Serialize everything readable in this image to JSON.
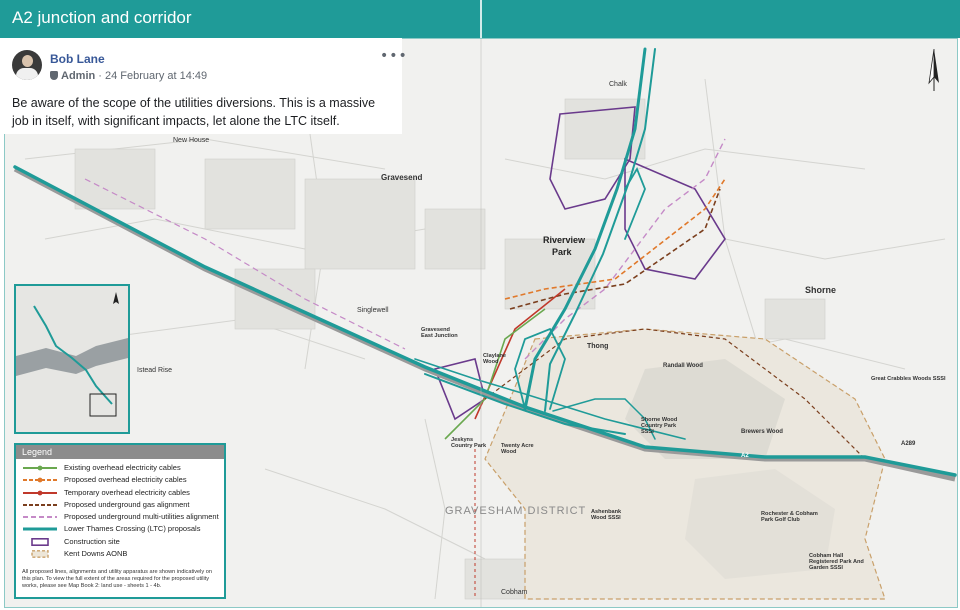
{
  "header": {
    "title": "A2 junction and corridor"
  },
  "post": {
    "author": "Bob Lane",
    "role": "Admin",
    "date": "24 February at 14:49",
    "more": "•••",
    "text": "Be aware of the scope of the utilities diversions. This is a massive job in itself, with significant impacts, let alone the LTC itself."
  },
  "map": {
    "labels": {
      "gravesend": "Gravesend",
      "riverview": "Riverview",
      "park": "Park",
      "shorne": "Shorne",
      "singlewell": "Singlewell",
      "chalk": "Chalk",
      "thong": "Thong",
      "randall_wood": "Randall Wood",
      "brewers_wood": "Brewers Wood",
      "great_crabbles": "Great Crabbles Woods SSSI",
      "gravesham": "GRAVESHAM DISTRICT",
      "cobham": "Cobham",
      "ashenbank": "Ashenbank Wood SSSI",
      "rochester_cobham": "Rochester & Cobham Park Golf Club",
      "cobham_hall": "Cobham Hall Registered Park And Garden SSSI",
      "jeskyns": "Jeskyns Country Park",
      "istead_rise": "Istead Rise",
      "new_house": "New House",
      "gravesend_east": "Gravesend East Junction",
      "shorne_wood": "Shorne Wood Country Park SSSI",
      "twenty_acre": "Twenty Acre Wood",
      "claylane": "Claylane Wood",
      "a2": "A2",
      "a289": "A289"
    },
    "legend": {
      "title": "Legend",
      "items": [
        {
          "label": "Existing overhead electricity cables",
          "color": "#6aa84f",
          "style": "solid-dot"
        },
        {
          "label": "Proposed overhead electricity cables",
          "color": "#e0792b",
          "style": "dash"
        },
        {
          "label": "Temporary overhead electricity cables",
          "color": "#c0392b",
          "style": "solid-dot"
        },
        {
          "label": "Proposed underground gas alignment",
          "color": "#7b3f1e",
          "style": "dash"
        },
        {
          "label": "Proposed underground multi-utilities alignment",
          "color": "#c58ac7",
          "style": "dash"
        },
        {
          "label": "Lower Thames Crossing (LTC) proposals",
          "color": "#1f9b98",
          "style": "solid"
        },
        {
          "label": "Construction site",
          "color": "#6a3a8c",
          "style": "box"
        },
        {
          "label": "Kent Downs AONB",
          "color": "#c9a06a",
          "style": "dashbox"
        }
      ],
      "note": "All proposed lines, alignments and utility apparatus are shown indicatively on this plan. To view the full extent of the areas required for the proposed utility works, please see Map Book 2: land use - sheets 1 - 4b."
    }
  }
}
